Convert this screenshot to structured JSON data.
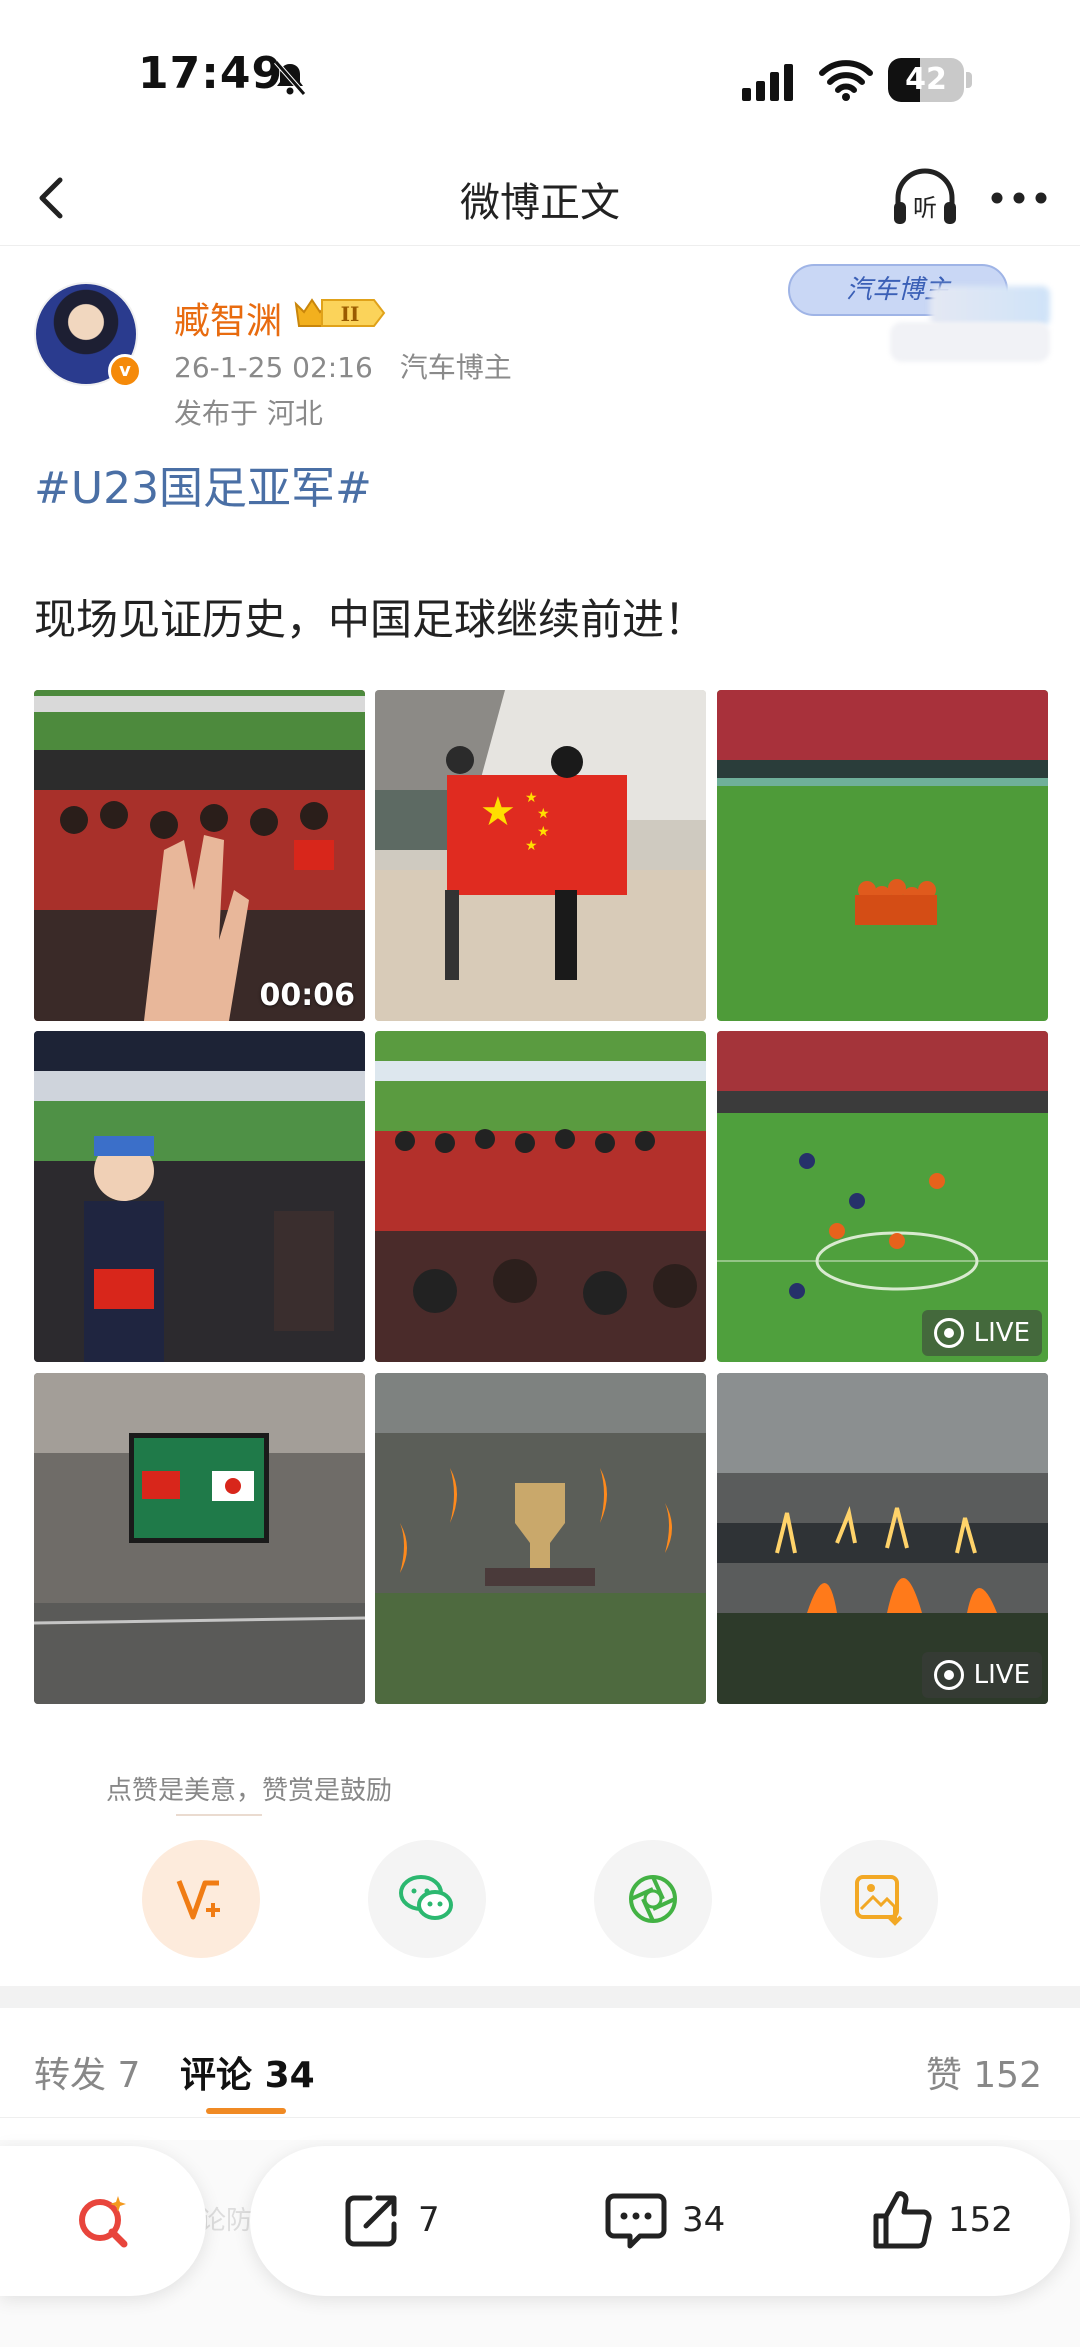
{
  "status_bar": {
    "time": "17:49",
    "battery_level": "42",
    "battery_fraction": 0.42
  },
  "nav": {
    "title": "微博正文",
    "listen_label": "听"
  },
  "post": {
    "author": "臧智渊",
    "vip_level": "II",
    "date": "26-1-25 02:16",
    "source": "汽车博主",
    "location": "发布于 河北",
    "fan_badge": "汽车博主",
    "hashtag": "#U23国足亚军#",
    "text": "现场见证历史，中国足球继续前进！",
    "media": [
      {
        "type": "video",
        "duration": "00:06"
      },
      {
        "type": "photo"
      },
      {
        "type": "photo"
      },
      {
        "type": "photo"
      },
      {
        "type": "photo"
      },
      {
        "type": "live",
        "label": "LIVE"
      },
      {
        "type": "photo"
      },
      {
        "type": "photo"
      },
      {
        "type": "live",
        "label": "LIVE"
      }
    ]
  },
  "reward": {
    "tip": "点赞是美意，赞赏是鼓励"
  },
  "tabs": {
    "repost_label": "转发",
    "repost_count": "7",
    "comment_label": "评论",
    "comment_count": "34",
    "like_label": "赞",
    "like_count": "152"
  },
  "bottom_bar": {
    "ghost_text": "论防",
    "repost": "7",
    "comment": "34",
    "like": "152"
  },
  "icons": [
    "back-icon",
    "headphone-icon",
    "more-icon",
    "reward-icon",
    "wechat-icon",
    "moments-icon",
    "save-image-icon",
    "search-icon",
    "share-icon",
    "comment-icon",
    "like-icon"
  ]
}
